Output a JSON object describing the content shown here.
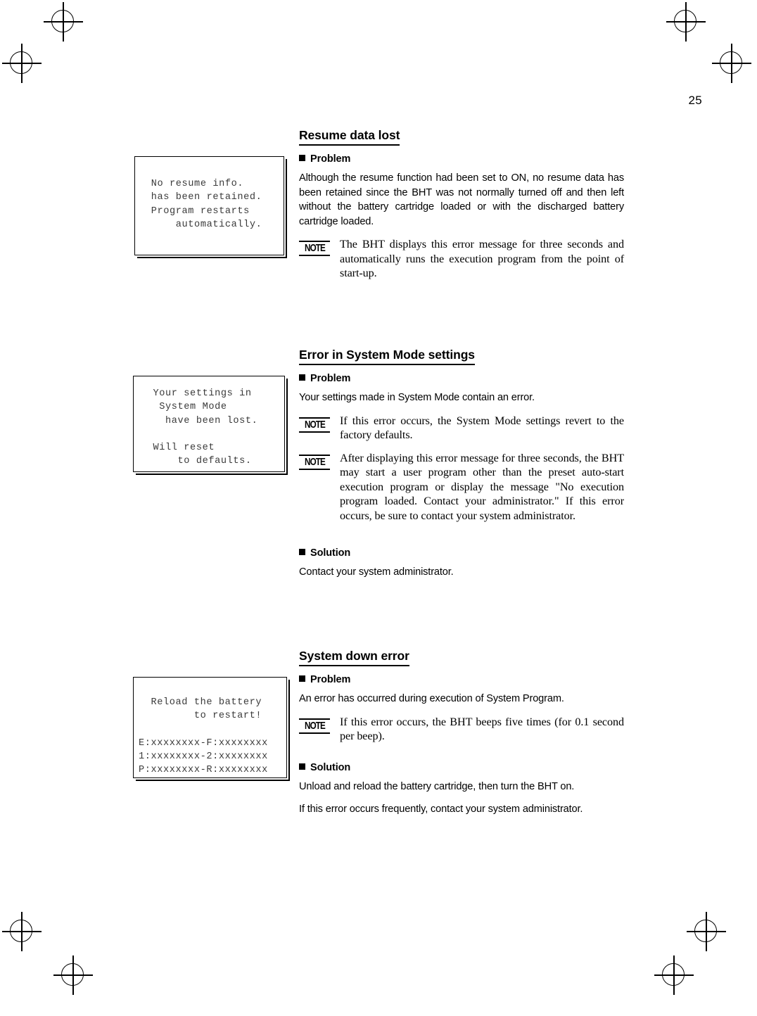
{
  "page": {
    "number": "25"
  },
  "marks": {
    "name": "registration-mark"
  },
  "sections": [
    {
      "id": "resume-data-lost",
      "title": "Resume data lost",
      "problem_label": "Problem",
      "problem_text": "Although the resume function had been set to ON, no resume data has been retained since the BHT was not normally turned off and then left without the battery cartridge loaded or with the discharged battery cartridge loaded.",
      "notes": [
        {
          "icon": "NOTE",
          "text": "The BHT displays this error message for three seconds and automatically runs the execution program from the point of start-up."
        }
      ],
      "solution_label": null,
      "solution_paragraphs": [],
      "screen": {
        "lines": [
          " No resume info.",
          " has been retained.",
          " Program restarts",
          "     automatically."
        ]
      }
    },
    {
      "id": "error-in-system-mode-settings",
      "title": "Error in System Mode settings",
      "problem_label": "Problem",
      "problem_text": "Your settings made in System Mode contain an error.",
      "notes": [
        {
          "icon": "NOTE",
          "text": "If this error occurs, the System Mode settings revert to the factory defaults."
        },
        {
          "icon": "NOTE",
          "text": "After displaying this error message for three seconds, the BHT may start a user program other than the preset auto-start execution program or display the message \"No execution program loaded. Contact your administrator.\" If this error occurs, be sure to contact your system administrator."
        }
      ],
      "solution_label": "Solution",
      "solution_paragraphs": [
        "Contact your system administrator."
      ],
      "screen": {
        "lines": [
          "  Your settings in",
          "   System Mode",
          "    have been lost.",
          "",
          "  Will reset",
          "      to defaults."
        ]
      }
    },
    {
      "id": "system-down-error",
      "title": "System down error",
      "problem_label": "Problem",
      "problem_text": "An error has occurred during execution of System Program.",
      "notes": [
        {
          "icon": "NOTE",
          "text": "If this error occurs, the BHT beeps five times (for 0.1 second per beep)."
        }
      ],
      "solution_label": "Solution",
      "solution_paragraphs": [
        "Unload and reload the battery cartridge, then turn the BHT on.",
        "If this error occurs frequently, contact your system administrator."
      ],
      "screen": {
        "lines": [
          "  Reload the battery",
          "         to restart!",
          "",
          "E:xxxxxxxx-F:xxxxxxxx",
          "1:xxxxxxxx-2:xxxxxxxx",
          "P:xxxxxxxx-R:xxxxxxxx"
        ]
      }
    }
  ]
}
